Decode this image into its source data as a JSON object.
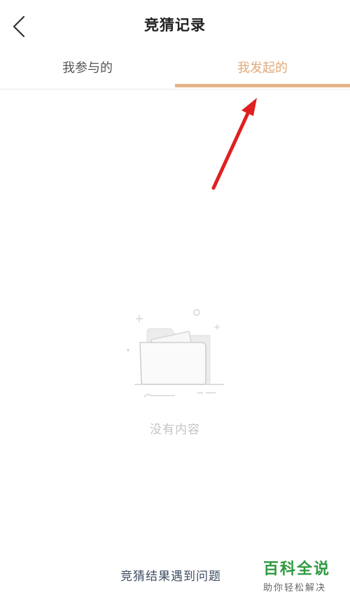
{
  "header": {
    "title": "竞猜记录",
    "back_icon": "chevron-left-icon"
  },
  "tabs": [
    {
      "label": "我参与的",
      "active": false
    },
    {
      "label": "我发起的",
      "active": true
    }
  ],
  "colors": {
    "active_tab": "#e2a97a",
    "indicator": "#e6b38a",
    "annotation_arrow": "#e02020",
    "watermark": "#2e9a3f"
  },
  "empty_state": {
    "icon": "empty-folder-icon",
    "text": "没有内容"
  },
  "footer": {
    "problem_link": "竞猜结果遇到问题"
  },
  "watermark": {
    "main": "百科全说",
    "sub": "助你轻松解决"
  }
}
